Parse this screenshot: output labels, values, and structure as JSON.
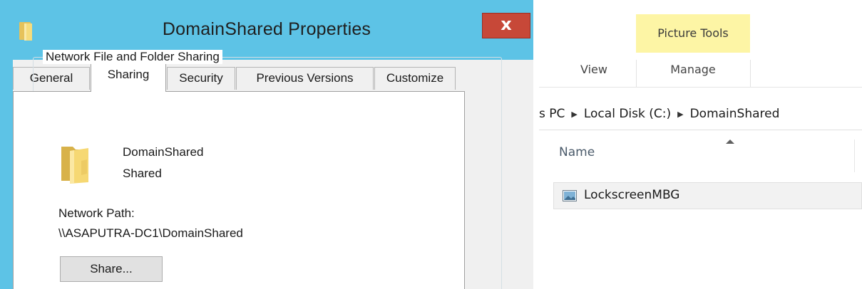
{
  "dialog": {
    "title": "DomainShared Properties",
    "close_glyph": "x",
    "tabs": [
      {
        "label": "General"
      },
      {
        "label": "Sharing"
      },
      {
        "label": "Security"
      },
      {
        "label": "Previous Versions"
      },
      {
        "label": "Customize"
      }
    ],
    "active_tab": "Sharing",
    "sharing": {
      "group_title": "Network File and Folder Sharing",
      "folder_name": "DomainShared",
      "folder_status": "Shared",
      "network_path_label": "Network Path:",
      "network_path": "\\\\ASAPUTRA-DC1\\DomainShared",
      "share_button": "Share..."
    },
    "icons": [
      "folder-icon",
      "close-icon"
    ]
  },
  "explorer": {
    "contextual_tab_group": "Picture Tools",
    "ribbon_tabs": [
      {
        "label": "View"
      },
      {
        "label": "Manage"
      }
    ],
    "breadcrumb": [
      {
        "label": "s PC"
      },
      {
        "label": "Local Disk (C:)"
      },
      {
        "label": "DomainShared"
      }
    ],
    "columns": [
      {
        "label": "Name"
      }
    ],
    "files": [
      {
        "name": "LockscreenMBG",
        "icon": "image-file-icon"
      }
    ]
  },
  "colors": {
    "titlebar": "#5dc3e6",
    "close_button": "#c74838",
    "picture_tools_highlight": "#fdf5a5",
    "dialog_body": "#f0f0f0"
  }
}
